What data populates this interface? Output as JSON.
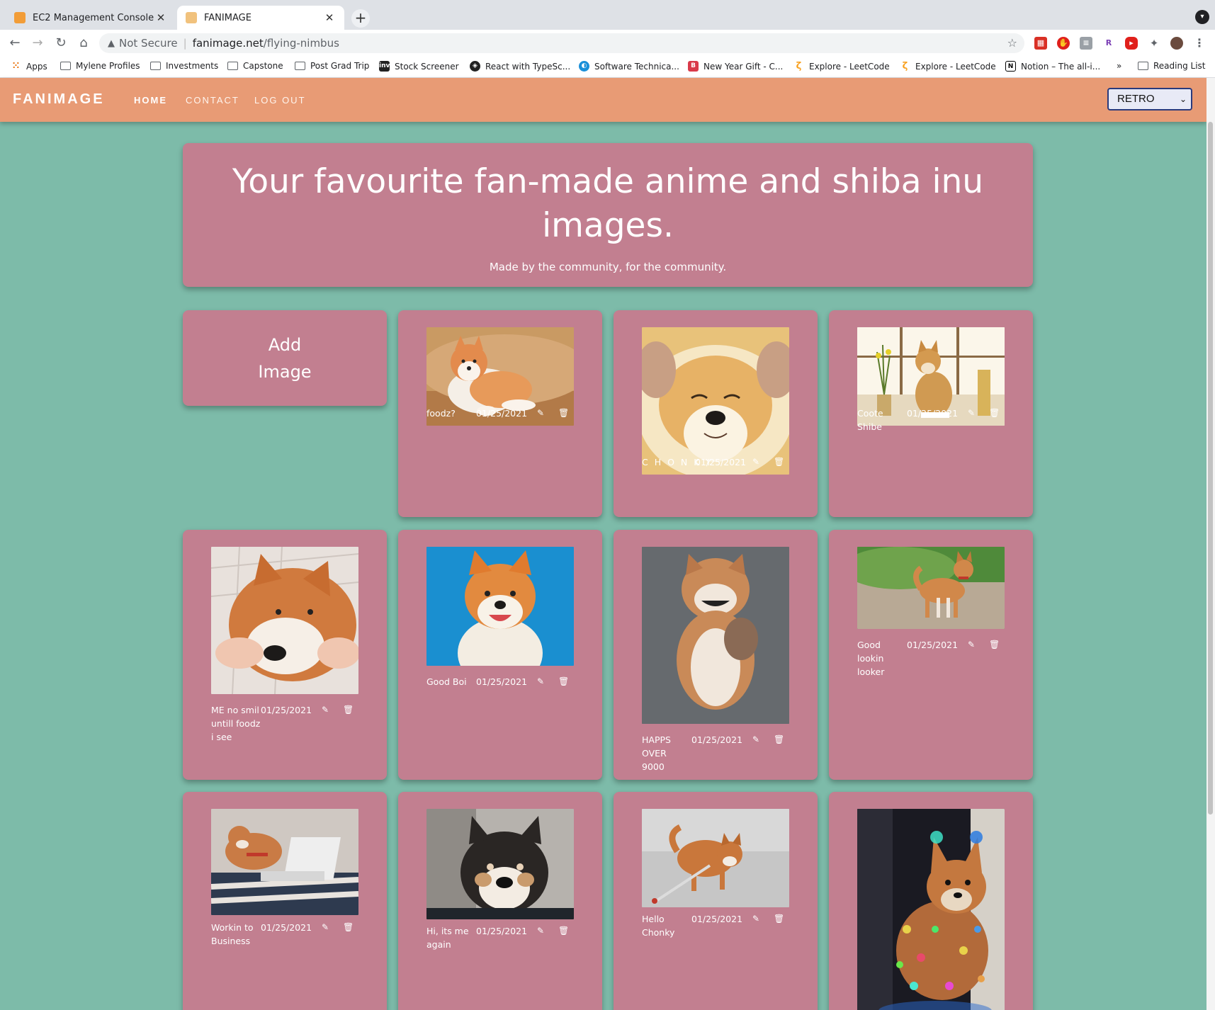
{
  "browser": {
    "tabs": [
      {
        "title": "EC2 Management Console",
        "active": false
      },
      {
        "title": "FANIMAGE",
        "active": true
      }
    ],
    "omnibox": {
      "security": "Not Secure",
      "domain": "fanimage.net",
      "path": "/flying-nimbus"
    },
    "bookmarks": [
      "Apps",
      "Mylene Profiles",
      "Investments",
      "Capstone",
      "Post Grad Trip",
      "Stock Screener",
      "React with TypeSc...",
      "Software Technica...",
      "New Year Gift - C...",
      "Explore - LeetCode",
      "Explore - LeetCode",
      "Notion – The all-i...",
      "»",
      "Reading List"
    ]
  },
  "site": {
    "brand": "FANIMAGE",
    "nav": {
      "home": "HOME",
      "contact": "CONTACT",
      "logout": "LOG OUT"
    },
    "theme": "RETRO",
    "hero": {
      "title": "Your favourite fan-made anime and shiba inu images.",
      "subtitle": "Made by the community, for the community."
    },
    "add_card": {
      "line1": "Add",
      "line2": "Image"
    },
    "cards": [
      {
        "caption": "foodz?",
        "date": "01/25/2021"
      },
      {
        "caption": "C H O N K Y",
        "date": "01/25/2021"
      },
      {
        "caption": "Coote Shibe",
        "date": "01/25/2021"
      },
      {
        "caption": "ME no smil untill foodz i see",
        "date": "01/25/2021"
      },
      {
        "caption": "Good Boi",
        "date": "01/25/2021"
      },
      {
        "caption": "HAPPS OVER 9000",
        "date": "01/25/2021"
      },
      {
        "caption": "Good lookin looker",
        "date": "01/25/2021"
      },
      {
        "caption": "Workin to Business",
        "date": "01/25/2021"
      },
      {
        "caption": "Hi, its me again",
        "date": "01/25/2021"
      },
      {
        "caption": "Hello Chonky",
        "date": "01/25/2021"
      },
      {
        "caption": "",
        "date": ""
      }
    ]
  },
  "colors": {
    "page_bg": "#7dbba9",
    "header_bg": "#e89b75",
    "card_bg": "#c27f90"
  }
}
